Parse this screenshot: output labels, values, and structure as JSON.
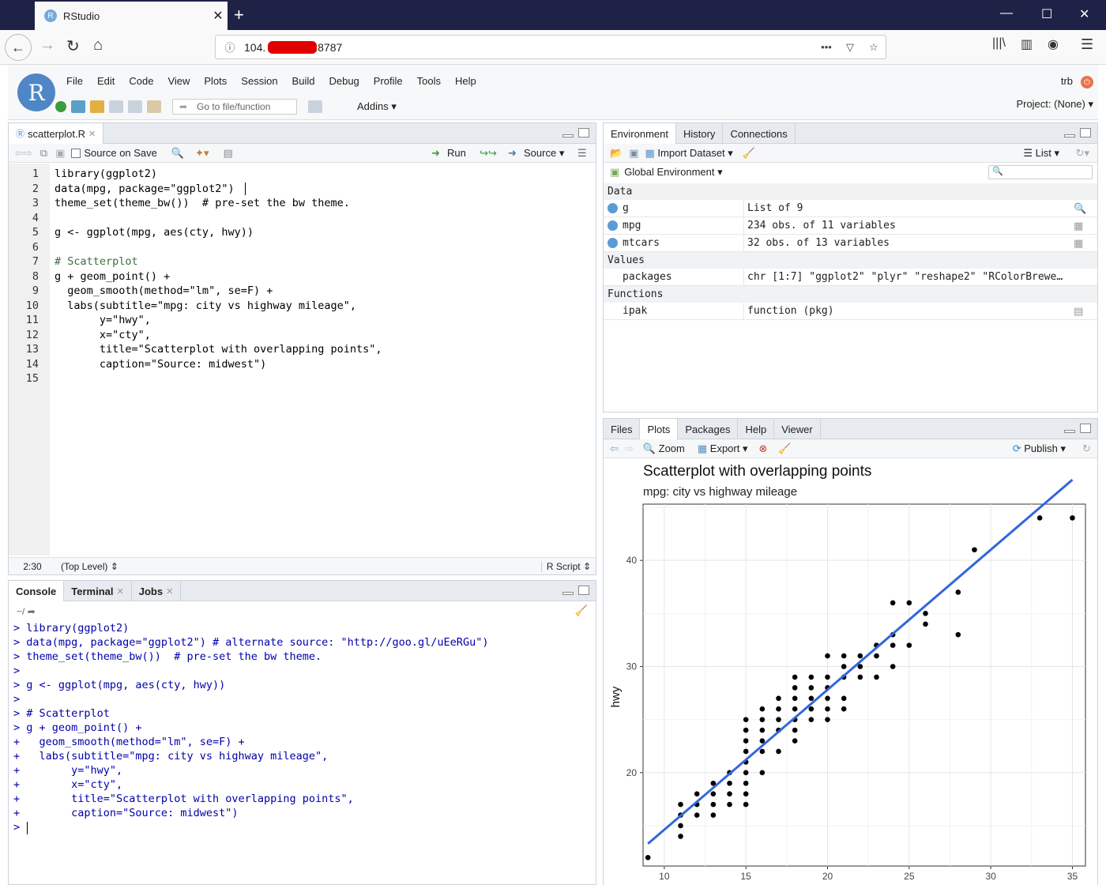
{
  "browser": {
    "tab_title": "RStudio",
    "url_visible_start": "104.",
    "url_visible_end": ":8787"
  },
  "rstudio": {
    "menu": [
      "File",
      "Edit",
      "Code",
      "View",
      "Plots",
      "Session",
      "Build",
      "Debug",
      "Profile",
      "Tools",
      "Help"
    ],
    "goto_placeholder": "Go to file/function",
    "addins_label": "Addins",
    "user": "trb",
    "project_label": "Project: (None)"
  },
  "editor": {
    "tab_label": "scatterplot.R",
    "source_on_save_label": "Source on Save",
    "run_label": "Run",
    "source_label": "Source",
    "lines": [
      "library(ggplot2)",
      "data(mpg, package=\"ggplot2\")",
      "theme_set(theme_bw())  # pre-set the bw theme.",
      "",
      "g <- ggplot(mpg, aes(cty, hwy))",
      "",
      "# Scatterplot",
      "g + geom_point() +",
      "  geom_smooth(method=\"lm\", se=F) +",
      "  labs(subtitle=\"mpg: city vs highway mileage\",",
      "       y=\"hwy\",",
      "       x=\"cty\",",
      "       title=\"Scatterplot with overlapping points\",",
      "       caption=\"Source: midwest\")",
      ""
    ],
    "line_numbers": [
      "1",
      "2",
      "3",
      "4",
      "5",
      "6",
      "7",
      "8",
      "9",
      "10",
      "11",
      "12",
      "13",
      "14",
      "15"
    ],
    "cursor_pos": "2:30",
    "scope": "(Top Level)",
    "file_type": "R Script"
  },
  "console": {
    "tabs": [
      "Console",
      "Terminal",
      "Jobs"
    ],
    "path": "~/",
    "lines": [
      "> library(ggplot2)",
      "> data(mpg, package=\"ggplot2\") # alternate source: \"http://goo.gl/uEeRGu\")",
      "> theme_set(theme_bw())  # pre-set the bw theme.",
      ">",
      "> g <- ggplot(mpg, aes(cty, hwy))",
      ">",
      "> # Scatterplot",
      "> g + geom_point() +",
      "+   geom_smooth(method=\"lm\", se=F) +",
      "+   labs(subtitle=\"mpg: city vs highway mileage\",",
      "+        y=\"hwy\",",
      "+        x=\"cty\",",
      "+        title=\"Scatterplot with overlapping points\",",
      "+        caption=\"Source: midwest\")",
      ">"
    ]
  },
  "environment": {
    "tabs": [
      "Environment",
      "History",
      "Connections"
    ],
    "import_label": "Import Dataset",
    "list_label": "List",
    "scope_label": "Global Environment",
    "sections": {
      "data": "Data",
      "values": "Values",
      "functions": "Functions"
    },
    "data_rows": [
      {
        "name": "g",
        "value": "List of 9"
      },
      {
        "name": "mpg",
        "value": "234 obs. of 11 variables"
      },
      {
        "name": "mtcars",
        "value": "32 obs. of 13 variables"
      }
    ],
    "value_rows": [
      {
        "name": "packages",
        "value": "chr [1:7] \"ggplot2\" \"plyr\" \"reshape2\" \"RColorBrewe…"
      }
    ],
    "function_rows": [
      {
        "name": "ipak",
        "value": "function (pkg)"
      }
    ]
  },
  "files": {
    "tabs": [
      "Files",
      "Plots",
      "Packages",
      "Help",
      "Viewer"
    ],
    "zoom_label": "Zoom",
    "export_label": "Export",
    "publish_label": "Publish"
  },
  "chart_data": {
    "type": "scatter",
    "title": "Scatterplot with overlapping points",
    "subtitle": "mpg: city vs highway mileage",
    "ylabel": "hwy",
    "xlim": [
      8.7,
      35.8
    ],
    "ylim": [
      11.2,
      45.3
    ],
    "xticks": [
      10,
      15,
      20,
      25,
      30,
      35
    ],
    "yticks": [
      20,
      30,
      40
    ],
    "grid": true,
    "points": [
      [
        9,
        12
      ],
      [
        11,
        14
      ],
      [
        11,
        15
      ],
      [
        11,
        16
      ],
      [
        11,
        17
      ],
      [
        12,
        16
      ],
      [
        12,
        17
      ],
      [
        12,
        18
      ],
      [
        13,
        16
      ],
      [
        13,
        17
      ],
      [
        13,
        18
      ],
      [
        13,
        19
      ],
      [
        14,
        17
      ],
      [
        14,
        18
      ],
      [
        14,
        19
      ],
      [
        14,
        20
      ],
      [
        15,
        17
      ],
      [
        15,
        18
      ],
      [
        15,
        19
      ],
      [
        15,
        20
      ],
      [
        15,
        21
      ],
      [
        15,
        22
      ],
      [
        15,
        23
      ],
      [
        15,
        24
      ],
      [
        15,
        25
      ],
      [
        16,
        20
      ],
      [
        16,
        22
      ],
      [
        16,
        23
      ],
      [
        16,
        24
      ],
      [
        16,
        25
      ],
      [
        16,
        26
      ],
      [
        17,
        22
      ],
      [
        17,
        24
      ],
      [
        17,
        25
      ],
      [
        17,
        26
      ],
      [
        17,
        27
      ],
      [
        18,
        23
      ],
      [
        18,
        24
      ],
      [
        18,
        25
      ],
      [
        18,
        26
      ],
      [
        18,
        27
      ],
      [
        18,
        28
      ],
      [
        18,
        29
      ],
      [
        19,
        25
      ],
      [
        19,
        26
      ],
      [
        19,
        27
      ],
      [
        19,
        28
      ],
      [
        19,
        29
      ],
      [
        20,
        25
      ],
      [
        20,
        26
      ],
      [
        20,
        27
      ],
      [
        20,
        28
      ],
      [
        20,
        29
      ],
      [
        20,
        31
      ],
      [
        21,
        26
      ],
      [
        21,
        27
      ],
      [
        21,
        29
      ],
      [
        21,
        30
      ],
      [
        21,
        31
      ],
      [
        22,
        29
      ],
      [
        22,
        30
      ],
      [
        22,
        31
      ],
      [
        23,
        29
      ],
      [
        23,
        31
      ],
      [
        23,
        32
      ],
      [
        24,
        30
      ],
      [
        24,
        32
      ],
      [
        24,
        33
      ],
      [
        24,
        36
      ],
      [
        25,
        32
      ],
      [
        25,
        36
      ],
      [
        26,
        34
      ],
      [
        26,
        35
      ],
      [
        28,
        33
      ],
      [
        28,
        37
      ],
      [
        29,
        41
      ],
      [
        33,
        44
      ],
      [
        35,
        44
      ]
    ],
    "fit_line": {
      "x": [
        9,
        35
      ],
      "y": [
        13.3,
        47.6
      ]
    }
  }
}
